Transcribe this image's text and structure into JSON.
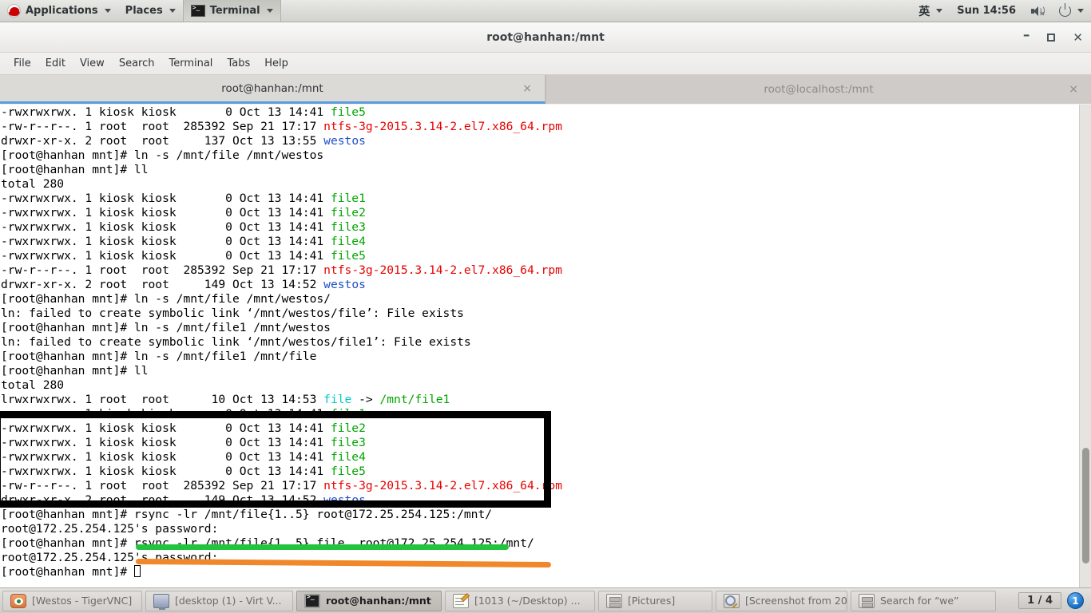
{
  "panel": {
    "logo_icon": "redhat-logo-icon",
    "applications_label": "Applications",
    "places_label": "Places",
    "active_app_label": "Terminal",
    "ime_label": "英",
    "clock": "Sun 14:56",
    "volume_icon": "volume-muted-icon",
    "power_icon": "power-icon"
  },
  "window": {
    "title": "root@hanhan:/mnt",
    "minimize_label": "–",
    "maximize_label": "",
    "close_label": "✕",
    "menu": [
      "File",
      "Edit",
      "View",
      "Search",
      "Terminal",
      "Tabs",
      "Help"
    ],
    "tabs": [
      {
        "label": "root@hanhan:/mnt",
        "close": "×",
        "active": true
      },
      {
        "label": "root@localhost:/mnt",
        "close": "×",
        "active": false
      }
    ]
  },
  "terminal": {
    "prompt": "[root@hanhan mnt]# ",
    "lines": [
      {
        "id": "l01",
        "segs": [
          {
            "t": "-rwxrwxrwx. 1 kiosk kiosk       0 Oct 13 14:41 "
          },
          {
            "t": "file5",
            "c": "c-green"
          }
        ]
      },
      {
        "id": "l02",
        "segs": [
          {
            "t": "-rw-r--r--. 1 root  root  285392 Sep 21 17:17 "
          },
          {
            "t": "ntfs-3g-2015.3.14-2.el7.x86_64.rpm",
            "c": "c-red"
          }
        ]
      },
      {
        "id": "l03",
        "segs": [
          {
            "t": "drwxr-xr-x. 2 root  root     137 Oct 13 13:55 "
          },
          {
            "t": "westos",
            "c": "c-blue"
          }
        ]
      },
      {
        "id": "l04",
        "segs": [
          {
            "t": "[root@hanhan mnt]# ln -s /mnt/file /mnt/westos"
          }
        ]
      },
      {
        "id": "l05",
        "segs": [
          {
            "t": "[root@hanhan mnt]# ll"
          }
        ]
      },
      {
        "id": "l06",
        "segs": [
          {
            "t": "total 280"
          }
        ]
      },
      {
        "id": "l07",
        "segs": [
          {
            "t": "-rwxrwxrwx. 1 kiosk kiosk       0 Oct 13 14:41 "
          },
          {
            "t": "file1",
            "c": "c-green"
          }
        ]
      },
      {
        "id": "l08",
        "segs": [
          {
            "t": "-rwxrwxrwx. 1 kiosk kiosk       0 Oct 13 14:41 "
          },
          {
            "t": "file2",
            "c": "c-green"
          }
        ]
      },
      {
        "id": "l09",
        "segs": [
          {
            "t": "-rwxrwxrwx. 1 kiosk kiosk       0 Oct 13 14:41 "
          },
          {
            "t": "file3",
            "c": "c-green"
          }
        ]
      },
      {
        "id": "l10",
        "segs": [
          {
            "t": "-rwxrwxrwx. 1 kiosk kiosk       0 Oct 13 14:41 "
          },
          {
            "t": "file4",
            "c": "c-green"
          }
        ]
      },
      {
        "id": "l11",
        "segs": [
          {
            "t": "-rwxrwxrwx. 1 kiosk kiosk       0 Oct 13 14:41 "
          },
          {
            "t": "file5",
            "c": "c-green"
          }
        ]
      },
      {
        "id": "l12",
        "segs": [
          {
            "t": "-rw-r--r--. 1 root  root  285392 Sep 21 17:17 "
          },
          {
            "t": "ntfs-3g-2015.3.14-2.el7.x86_64.rpm",
            "c": "c-red"
          }
        ]
      },
      {
        "id": "l13",
        "segs": [
          {
            "t": "drwxr-xr-x. 2 root  root     149 Oct 13 14:52 "
          },
          {
            "t": "westos",
            "c": "c-blue"
          }
        ]
      },
      {
        "id": "l14",
        "segs": [
          {
            "t": "[root@hanhan mnt]# ln -s /mnt/file /mnt/westos/"
          }
        ]
      },
      {
        "id": "l15",
        "segs": [
          {
            "t": "ln: failed to create symbolic link ‘/mnt/westos/file’: File exists"
          }
        ]
      },
      {
        "id": "l16",
        "segs": [
          {
            "t": "[root@hanhan mnt]# ln -s /mnt/file1 /mnt/westos"
          }
        ]
      },
      {
        "id": "l17",
        "segs": [
          {
            "t": "ln: failed to create symbolic link ‘/mnt/westos/file1’: File exists"
          }
        ]
      },
      {
        "id": "l18",
        "segs": [
          {
            "t": "[root@hanhan mnt]# ln -s /mnt/file1 /mnt/file"
          }
        ]
      },
      {
        "id": "l19",
        "segs": [
          {
            "t": "[root@hanhan mnt]# ll"
          }
        ]
      },
      {
        "id": "l20",
        "segs": [
          {
            "t": "total 280"
          }
        ]
      },
      {
        "id": "l21",
        "segs": [
          {
            "t": "lrwxrwxrwx. 1 root  root      10 Oct 13 14:53 "
          },
          {
            "t": "file",
            "c": "c-cyan"
          },
          {
            "t": " -> "
          },
          {
            "t": "/mnt/file1",
            "c": "c-green"
          }
        ]
      },
      {
        "id": "l22",
        "segs": [
          {
            "t": "-rwxrwxrwx. 1 kiosk kiosk       0 Oct 13 14:41 "
          },
          {
            "t": "file1",
            "c": "c-green"
          }
        ]
      },
      {
        "id": "l23",
        "segs": [
          {
            "t": "-rwxrwxrwx. 1 kiosk kiosk       0 Oct 13 14:41 "
          },
          {
            "t": "file2",
            "c": "c-green"
          }
        ]
      },
      {
        "id": "l24",
        "segs": [
          {
            "t": "-rwxrwxrwx. 1 kiosk kiosk       0 Oct 13 14:41 "
          },
          {
            "t": "file3",
            "c": "c-green"
          }
        ]
      },
      {
        "id": "l25",
        "segs": [
          {
            "t": "-rwxrwxrwx. 1 kiosk kiosk       0 Oct 13 14:41 "
          },
          {
            "t": "file4",
            "c": "c-green"
          }
        ]
      },
      {
        "id": "l26",
        "segs": [
          {
            "t": "-rwxrwxrwx. 1 kiosk kiosk       0 Oct 13 14:41 "
          },
          {
            "t": "file5",
            "c": "c-green"
          }
        ]
      },
      {
        "id": "l27",
        "segs": [
          {
            "t": "-rw-r--r--. 1 root  root  285392 Sep 21 17:17 "
          },
          {
            "t": "ntfs-3g-2015.3.14-2.el7.x86_64.rpm",
            "c": "c-red"
          }
        ]
      },
      {
        "id": "l28",
        "segs": [
          {
            "t": "drwxr-xr-x. 2 root  root     149 Oct 13 14:52 "
          },
          {
            "t": "westos",
            "c": "c-blue"
          }
        ]
      },
      {
        "id": "l29",
        "segs": [
          {
            "t": "[root@hanhan mnt]# rsync -lr /mnt/file{1..5} root@172.25.254.125:/mnt/"
          }
        ]
      },
      {
        "id": "l30",
        "segs": [
          {
            "t": "root@172.25.254.125's password:"
          }
        ]
      },
      {
        "id": "l31",
        "segs": [
          {
            "t": "[root@hanhan mnt]# rsync -lr /mnt/file{1..5} file  root@172.25.254.125:/mnt/"
          }
        ]
      },
      {
        "id": "l32",
        "segs": [
          {
            "t": "root@172.25.254.125's password:"
          }
        ]
      },
      {
        "id": "l33",
        "segs": [
          {
            "t": "[root@hanhan mnt]# "
          },
          {
            "cursor": true
          }
        ]
      }
    ],
    "colors": {
      "green": "#00a500",
      "red": "#e80000",
      "blue": "#1f4ec7",
      "cyan": "#00c8c8",
      "background": "#ffffff",
      "foreground": "#000000"
    }
  },
  "annotations": {
    "box_color": "#000000",
    "underline_green": "#22c33d",
    "underline_orange": "#f0872a"
  },
  "taskbar": {
    "items": [
      {
        "label": "[Westos - TigerVNC]",
        "icon": "vnc-icon",
        "active": false
      },
      {
        "label": "[desktop (1) - Virt V...",
        "icon": "monitor-icon",
        "active": false
      },
      {
        "label": "root@hanhan:/mnt",
        "icon": "terminal-icon",
        "active": true
      },
      {
        "label": "[1013 (~/Desktop) ...",
        "icon": "notes-icon",
        "active": false
      },
      {
        "label": "[Pictures]",
        "icon": "files-icon",
        "active": false
      },
      {
        "label": "[Screenshot from 20...",
        "icon": "screenshot-icon",
        "active": false
      },
      {
        "label": "Search for “we”",
        "icon": "files-icon",
        "active": false
      }
    ],
    "page_indicator": "1 / 4",
    "workspace_badge": "1"
  }
}
